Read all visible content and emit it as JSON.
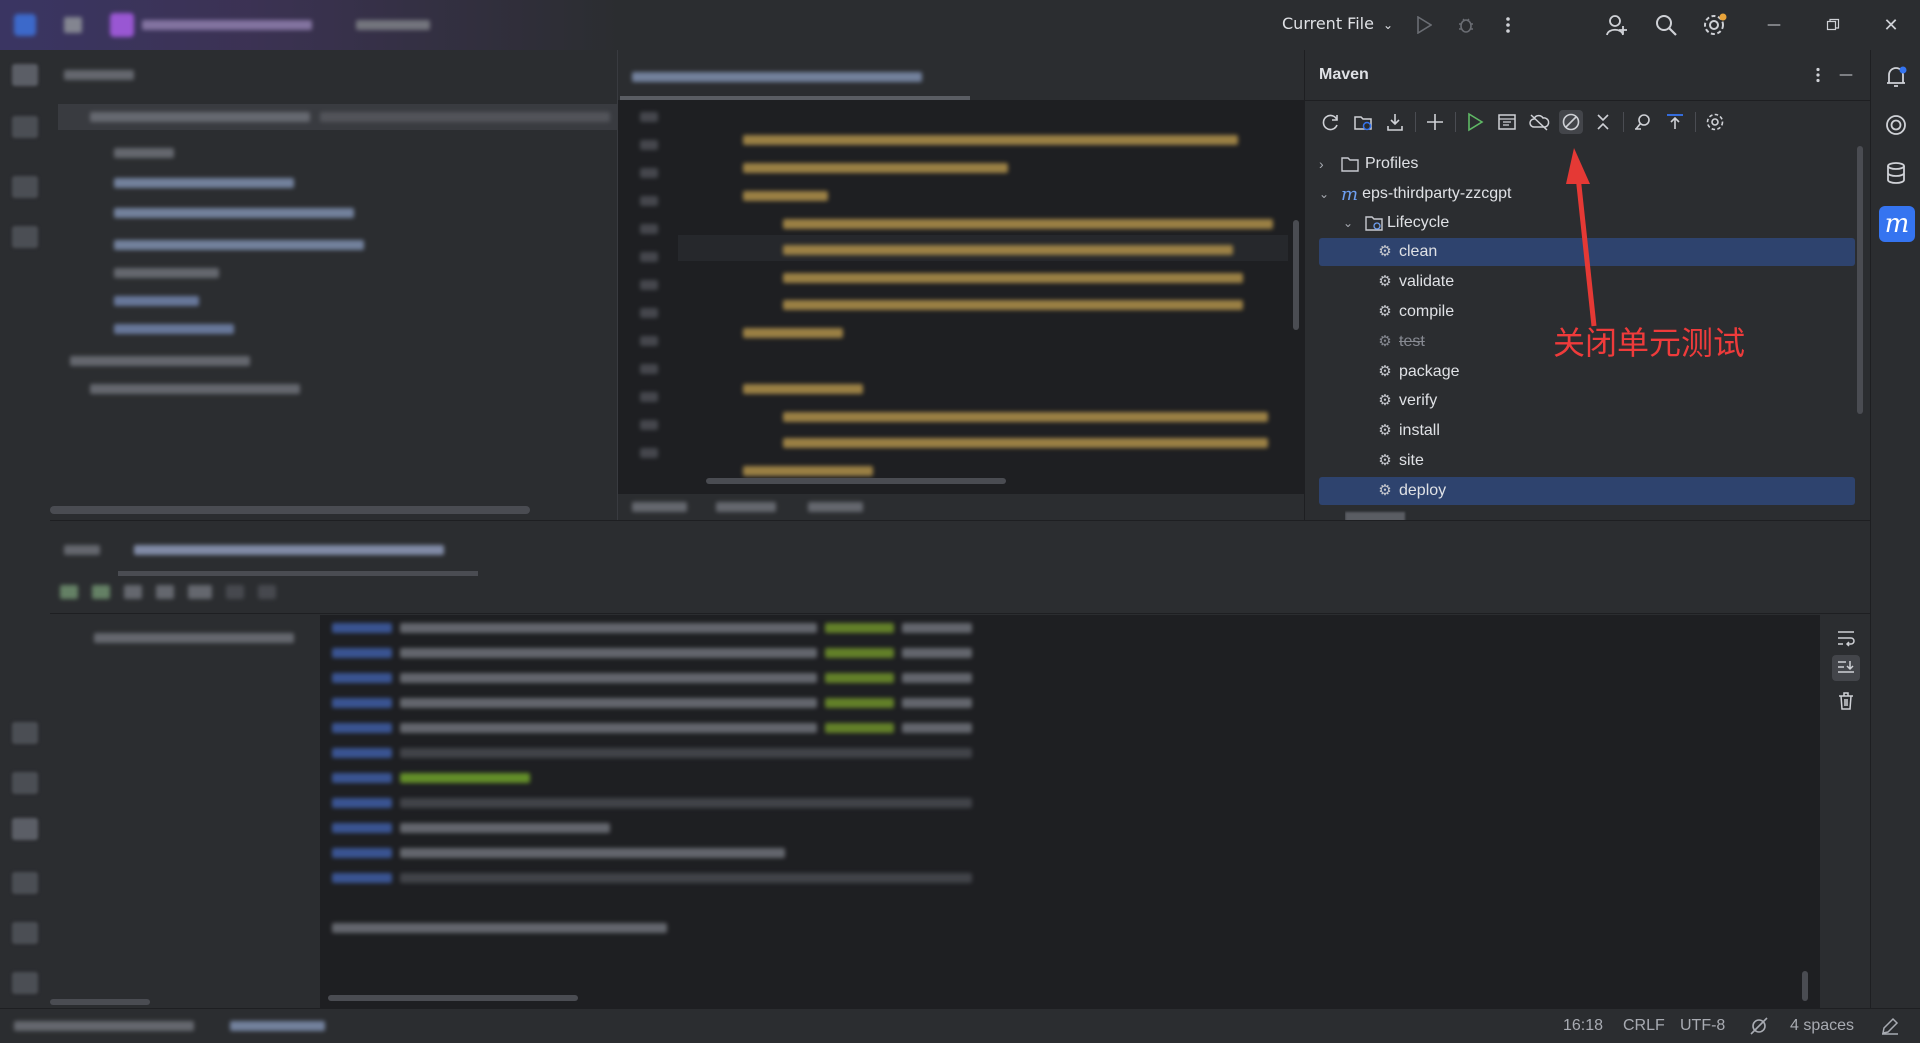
{
  "titlebar": {
    "run_config": "Current File",
    "run_config_chevron": "chevron-down-icon",
    "icons": [
      "run-icon",
      "debug-icon",
      "more-vertical-icon",
      "add-user-icon",
      "search-icon",
      "settings-icon",
      "minimize-icon",
      "restore-icon",
      "close-icon"
    ]
  },
  "maven": {
    "title": "Maven",
    "toolbar_icons": [
      "reload-icon",
      "add-folder-icon",
      "download-icon",
      "plus-icon",
      "run-icon",
      "execute-goal-icon",
      "offline-icon",
      "skip-tests-icon",
      "collapse-icon",
      "dependency-analyzer-icon",
      "show-ignored-icon",
      "maven-settings-icon"
    ],
    "tree": {
      "profiles_label": "Profiles",
      "project_label": "eps-thirdparty-zzcgpt",
      "lifecycle_label": "Lifecycle",
      "goals": [
        {
          "label": "clean",
          "selected": true,
          "disabled": false
        },
        {
          "label": "validate",
          "selected": false,
          "disabled": false
        },
        {
          "label": "compile",
          "selected": false,
          "disabled": false
        },
        {
          "label": "test",
          "selected": false,
          "disabled": true
        },
        {
          "label": "package",
          "selected": false,
          "disabled": false
        },
        {
          "label": "verify",
          "selected": false,
          "disabled": false
        },
        {
          "label": "install",
          "selected": false,
          "disabled": false
        },
        {
          "label": "site",
          "selected": false,
          "disabled": false
        },
        {
          "label": "deploy",
          "selected": true,
          "disabled": false
        }
      ]
    }
  },
  "annotation": {
    "text": "关闭单元测试",
    "color": "#ef3b3b"
  },
  "statusbar": {
    "position": "16:18",
    "line_separator": "CRLF",
    "encoding": "UTF-8",
    "indent": "4 spaces"
  },
  "colors": {
    "selection": "#2e436e",
    "accent": "#3574f0",
    "run_green": "#5fb865"
  }
}
